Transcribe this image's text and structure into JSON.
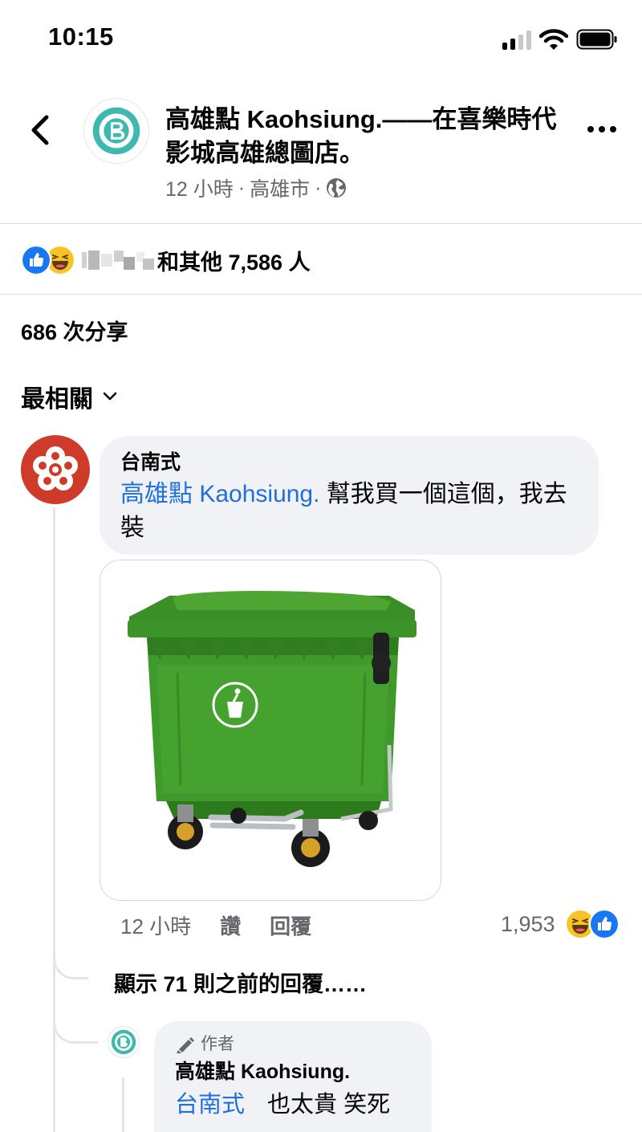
{
  "status_bar": {
    "time": "10:15"
  },
  "post": {
    "title": "高雄點 Kaohsiung.——在喜樂時代影城高雄總圖店。",
    "time": "12 小時",
    "location": "高雄市",
    "dot": "·"
  },
  "reactions": {
    "summary": "和其他 7,586 人"
  },
  "shares": "686 次分享",
  "sort": {
    "label": "最相關"
  },
  "comment": {
    "author": "台南式",
    "mention": "高雄點 Kaohsiung.",
    "text": " 幫我買一個這個，我去裝",
    "time": "12 小時",
    "like": "讚",
    "reply": "回覆",
    "reaction_count": "1,953"
  },
  "previous_replies": "顯示 71 則之前的回覆……",
  "reply": {
    "badge": "作者",
    "author": "高雄點 Kaohsiung.",
    "mention": "台南式",
    "text": "也太貴 笑死"
  },
  "colors": {
    "link": "#216fdb",
    "like_blue": "#1877f2",
    "haha_yellow": "#f7c329",
    "page_teal": "#3fb8b0"
  }
}
